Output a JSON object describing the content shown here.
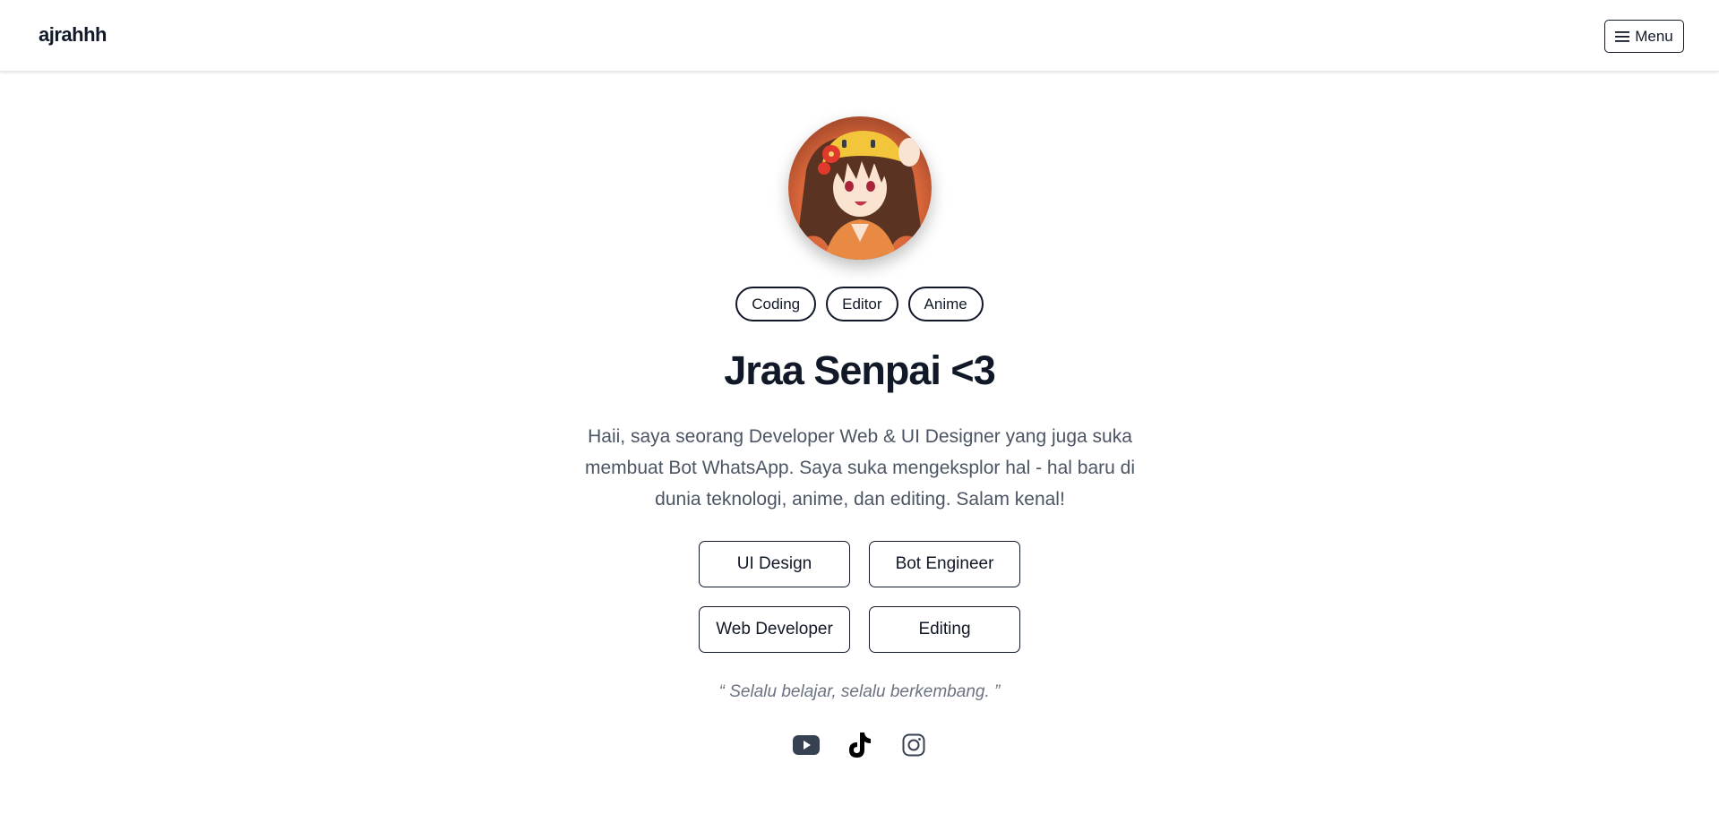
{
  "header": {
    "brand": "ajrahhh",
    "menu_label": "Menu"
  },
  "profile": {
    "tags": [
      "Coding",
      "Editor",
      "Anime"
    ],
    "name": "Jraa Senpai <3",
    "bio": "Haii, saya seorang Developer Web & UI Designer yang juga suka membuat Bot WhatsApp. Saya suka mengeksplor hal - hal baru di dunia teknologi, anime, dan editing. Salam kenal!",
    "skills": [
      "UI Design",
      "Bot Engineer",
      "Web Developer",
      "Editing"
    ],
    "quote": "“ Selalu belajar, selalu berkembang. ”"
  },
  "socials": [
    {
      "icon": "youtube-icon"
    },
    {
      "icon": "tiktok-icon"
    },
    {
      "icon": "instagram-icon"
    }
  ],
  "colors": {
    "text": "#111827",
    "muted": "#4b5563",
    "quote": "#6b7280",
    "youtube": "#374151"
  }
}
